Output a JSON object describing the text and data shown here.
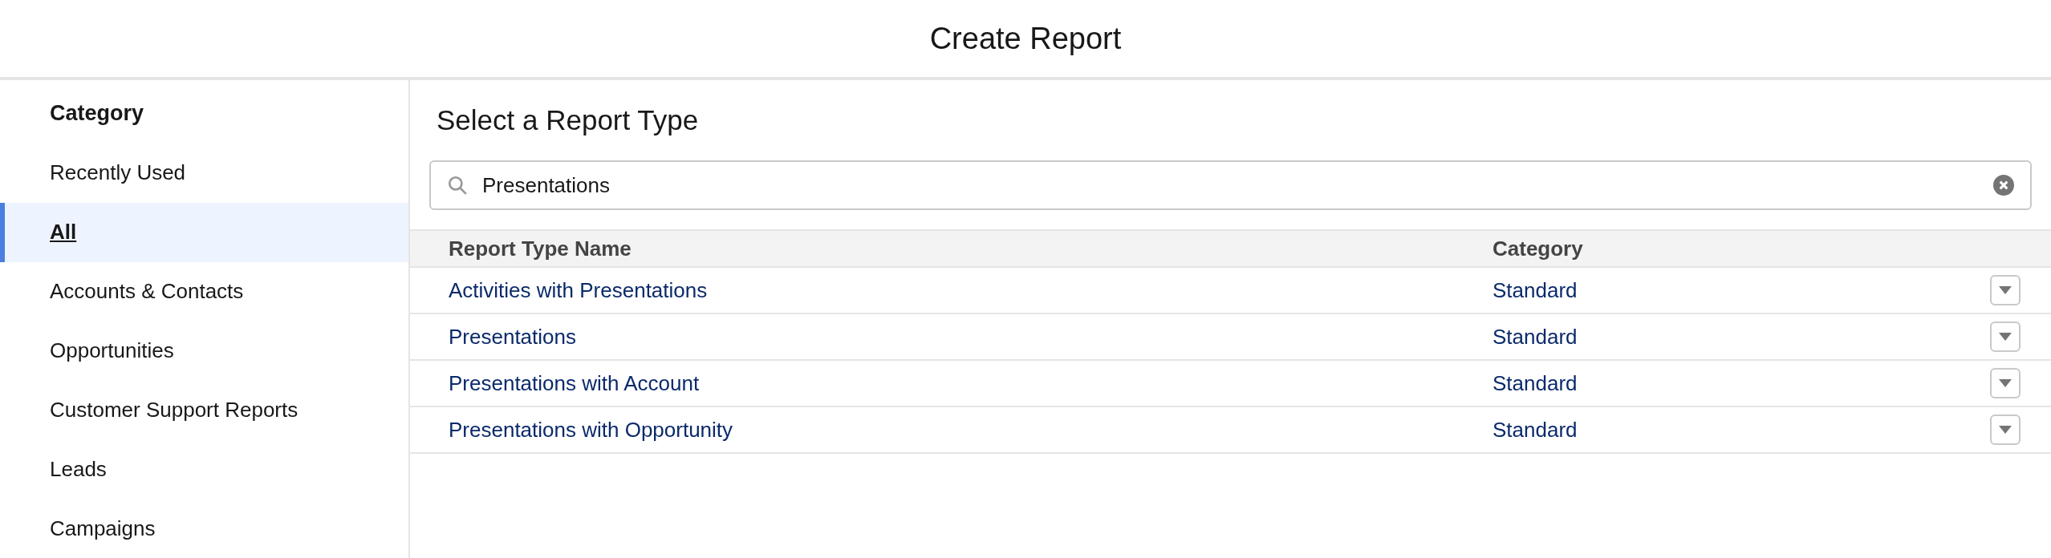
{
  "header": {
    "title": "Create Report"
  },
  "sidebar": {
    "heading": "Category",
    "items": [
      {
        "label": "Recently Used",
        "selected": false
      },
      {
        "label": "All",
        "selected": true
      },
      {
        "label": "Accounts & Contacts",
        "selected": false
      },
      {
        "label": "Opportunities",
        "selected": false
      },
      {
        "label": "Customer Support Reports",
        "selected": false
      },
      {
        "label": "Leads",
        "selected": false
      },
      {
        "label": "Campaigns",
        "selected": false
      }
    ]
  },
  "main": {
    "heading": "Select a Report Type",
    "search": {
      "value": "Presentations"
    },
    "table": {
      "columns": [
        "Report Type Name",
        "Category"
      ],
      "rows": [
        {
          "name": "Activities with Presentations",
          "category": "Standard"
        },
        {
          "name": "Presentations",
          "category": "Standard"
        },
        {
          "name": "Presentations with Account",
          "category": "Standard"
        },
        {
          "name": "Presentations with Opportunity",
          "category": "Standard"
        }
      ]
    }
  }
}
